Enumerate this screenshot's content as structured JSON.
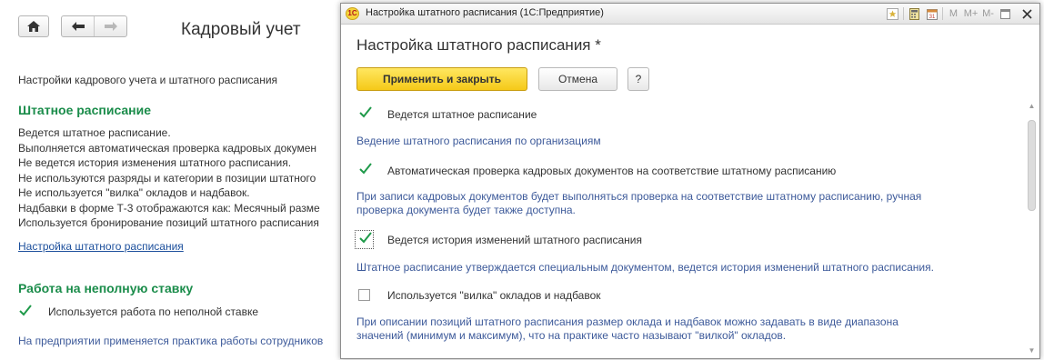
{
  "background": {
    "page_title": "Кадровый учет",
    "settings_caption": "Настройки кадрового учета и штатного расписания",
    "staffing_section": {
      "heading": "Штатное расписание",
      "lines": [
        "Ведется штатное расписание.",
        "Выполняется автоматическая проверка кадровых докумен",
        "Не ведется история изменения штатного расписания.",
        "Не используются разряды и категории в позиции штатного",
        "Не используется \"вилка\" окладов и надбавок.",
        "Надбавки в форме Т-3 отображаются как: Месячный разме",
        "Используется бронирование позиций штатного расписания"
      ],
      "link": "Настройка штатного расписания"
    },
    "parttime_section": {
      "heading": "Работа на неполную ставку",
      "checkbox_label": "Используется работа по неполной ставке",
      "checkbox_checked": true,
      "note": "На предприятии применяется практика работы сотрудников"
    }
  },
  "dialog": {
    "window_title": "Настройка штатного расписания  (1С:Предприятие)",
    "app_logo_text": "1С",
    "titlebar_icons": [
      "favorite-star-icon",
      "calculator-icon",
      "calendar-icon",
      "M",
      "M+",
      "M-",
      "window-restore-icon",
      "close-icon"
    ],
    "heading": "Настройка штатного расписания *",
    "buttons": {
      "apply": "Применить и закрыть",
      "cancel": "Отмена",
      "help": "?"
    },
    "options": [
      {
        "label": "Ведется штатное расписание",
        "checked": true,
        "hint": [
          "Ведение штатного расписания по организациям"
        ]
      },
      {
        "label": "Автоматическая проверка кадровых документов на соответствие штатному расписанию",
        "checked": true,
        "hint": [
          "При записи кадровых документов будет выполняться проверка на соответствие штатному расписанию, ручная",
          "проверка документа будет также доступна."
        ]
      },
      {
        "label": "Ведется история изменений штатного расписания",
        "checked": true,
        "focused": true,
        "hint": [
          "Штатное расписание утверждается специальным документом, ведется история изменений штатного расписания."
        ]
      },
      {
        "label": "Используется \"вилка\" окладов и надбавок",
        "checked": false,
        "hint": [
          "При описании позиций штатного расписания размер оклада и надбавок можно задавать в виде диапазона",
          "значений (минимум и максимум), что на практике часто называют \"вилкой\" окладов."
        ]
      }
    ]
  },
  "colors": {
    "section_heading": "#1a8c4a",
    "link": "#1c4f9c",
    "hint_text": "#3d5a9a",
    "apply_button": "#f5c918",
    "checkmark": "#1f9a4a"
  }
}
